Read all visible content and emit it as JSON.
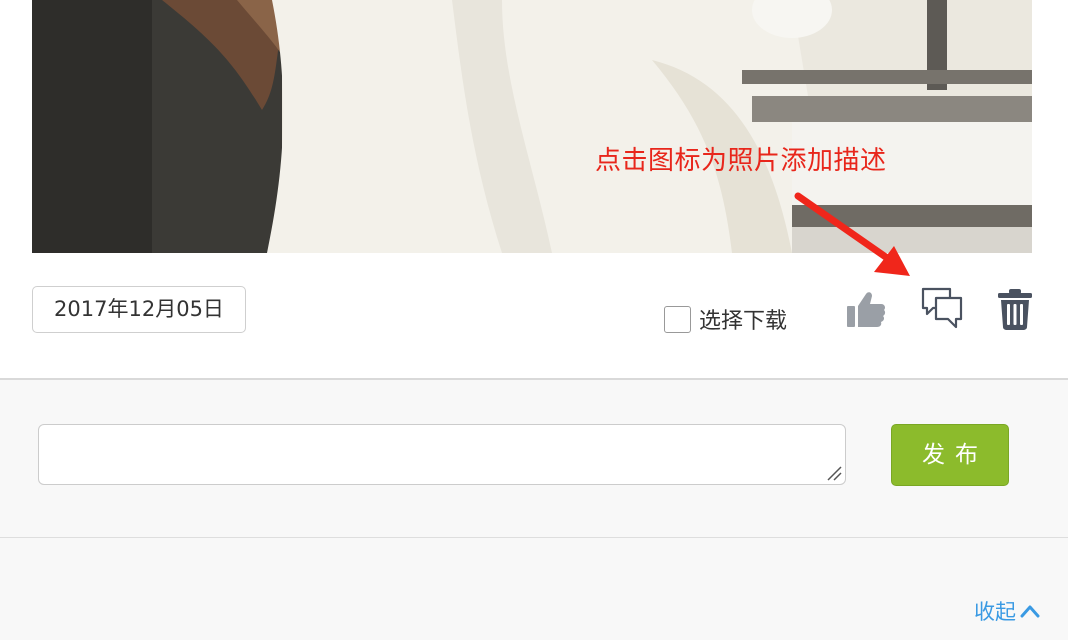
{
  "annotation": {
    "text": "点击图标为照片添加描述"
  },
  "photo_card": {
    "date": "2017年12月05日",
    "download_label": "选择下载",
    "download_checked": false
  },
  "icons": {
    "like": "thumbs-up-icon",
    "comment": "comment-bubbles-icon",
    "delete": "trash-icon",
    "collapse": "chevron-up-icon"
  },
  "comment_box": {
    "value": "",
    "placeholder": "",
    "publish_label": "发布"
  },
  "footer": {
    "collapse_label": "收起"
  },
  "colors": {
    "annotation": "#e8261b",
    "publish_button": "#8cbb2c",
    "link": "#3a9ae3",
    "icon_dark": "#4a5260",
    "like_icon": "#9a9fa6"
  }
}
